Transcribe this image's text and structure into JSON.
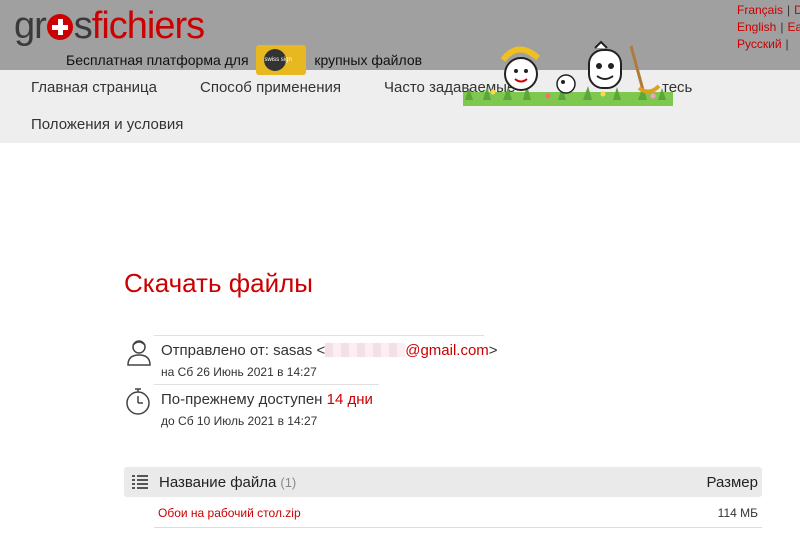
{
  "brand": {
    "logo_part1": "gr",
    "logo_part2": "s",
    "logo_part3": "fichiers",
    "tagline_before": "Бесплатная платформа для",
    "tagline_after": "крупных файлов",
    "badge_text": "swiss sign"
  },
  "languages": [
    {
      "label": "Français",
      "sep": "|",
      "next": "D"
    },
    {
      "label": "English",
      "sep": "|",
      "next": "Ea"
    },
    {
      "label": "Русский",
      "sep": "|",
      "next": ""
    }
  ],
  "nav": {
    "home": "Главная страница",
    "usage": "Способ применения",
    "faq": "Часто задаваемые",
    "contact": "тесь",
    "terms": "Положения и условия"
  },
  "page": {
    "title": "Скачать файлы"
  },
  "sender": {
    "label": "Отправлено от:",
    "name": "sasas",
    "email_open": "<",
    "email_domain": "@gmail.com",
    "email_close": ">",
    "sent_prefix": "на",
    "sent_date": "Сб 26 Июнь 2021 в 14:27"
  },
  "availability": {
    "label": "По-прежнему доступен",
    "days": "14 дни",
    "until_prefix": "до",
    "until_date": "Сб 10 Июль 2021 в 14:27"
  },
  "files": {
    "header_name": "Название файла",
    "count": "(1)",
    "header_size": "Размер",
    "rows": [
      {
        "name": "Обои на рабочий стол.zip",
        "size": "114 МБ"
      }
    ]
  },
  "colors": {
    "accent": "#cc0000",
    "topbar": "#a0a0a0",
    "navbar": "#eeeeee"
  }
}
